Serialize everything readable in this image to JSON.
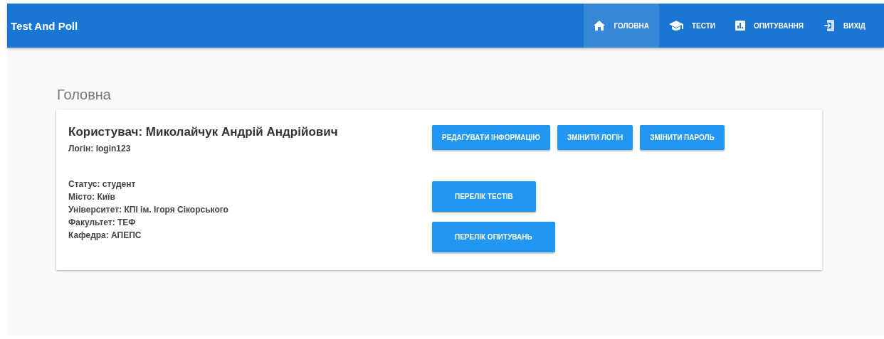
{
  "app_bar": {
    "title": "Test And Poll",
    "nav": [
      {
        "label": "ГОЛОВНА",
        "selected": true
      },
      {
        "label": "ТЕСТИ",
        "selected": false
      },
      {
        "label": "ОПИТУВАННЯ",
        "selected": false
      },
      {
        "label": "ВИХІД",
        "selected": false
      }
    ]
  },
  "page": {
    "heading": "Головна",
    "card": {
      "user": "Користувач: Миколайчук Андрій Андрійович",
      "login": "Логін: login123",
      "details": [
        "Статус: студент",
        "Місто: Київ",
        "Університет: КПІ ім. Ігоря Сікорського",
        "Факультет: ТЕФ",
        "Кафедра: АПЕПС"
      ],
      "top_buttons": [
        "РЕДАГУВАТИ ІНФОРМАЦІЮ",
        "ЗМІНИТИ ЛОГІН",
        "ЗМІНИТИ ПАРОЛЬ"
      ],
      "list_buttons": [
        "ПЕРЕЛІК ТЕСТІВ",
        "ПЕРЕЛІК ОПИТУВАНЬ"
      ]
    }
  }
}
